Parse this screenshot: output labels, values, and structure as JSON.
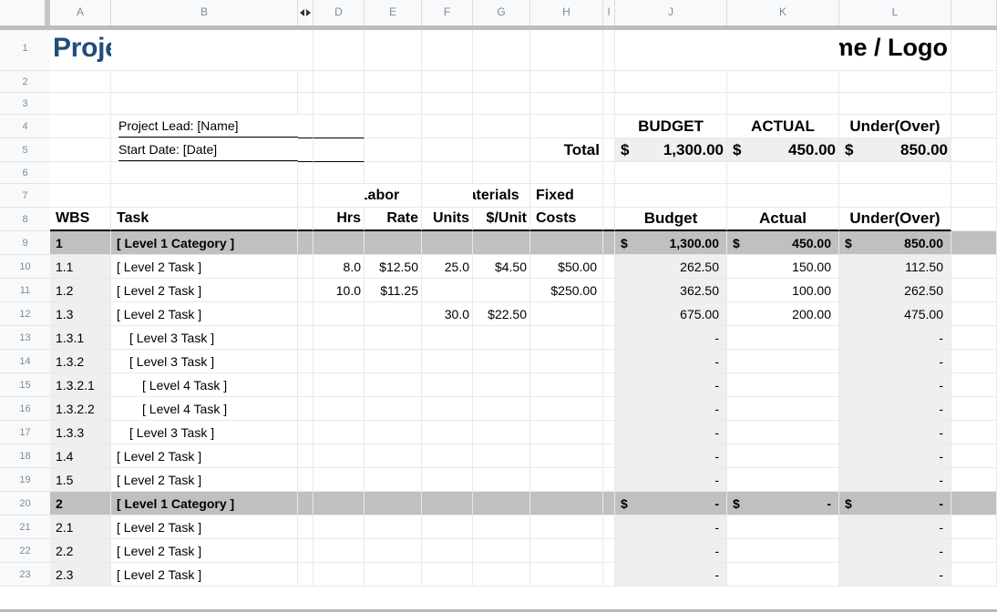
{
  "columns": {
    "letters": [
      "A",
      "B",
      "D",
      "E",
      "F",
      "G",
      "H",
      "I",
      "J",
      "K",
      "L"
    ],
    "hidden_marker": "hidden-columns-c"
  },
  "rows": {
    "numbers": [
      "1",
      "2",
      "3",
      "4",
      "5",
      "6",
      "7",
      "8",
      "9",
      "10",
      "11",
      "12",
      "13",
      "14",
      "15",
      "16",
      "17",
      "18",
      "19",
      "20",
      "21",
      "22",
      "23"
    ]
  },
  "header": {
    "title": "Project Budget",
    "company": "Company Name / Logo"
  },
  "meta": {
    "project_lead": "Project Lead: [Name]",
    "start_date": "Start Date: [Date]"
  },
  "summary": {
    "budget_label": "BUDGET",
    "actual_label": "ACTUAL",
    "underover_label": "Under(Over)",
    "total_label": "Total",
    "budget_currency": "$",
    "budget_value": "1,300.00",
    "actual_currency": "$",
    "actual_value": "450.00",
    "underover_currency": "$",
    "underover_value": "850.00"
  },
  "table_header": {
    "group_labor": "Labor",
    "group_materials": "Materials",
    "group_fixed": "Fixed",
    "wbs": "WBS",
    "task": "Task",
    "hrs": "Hrs",
    "rate": "Rate",
    "units": "Units",
    "per_unit": "$/Unit",
    "costs": "Costs",
    "budget": "Budget",
    "actual": "Actual",
    "underover": "Under(Over)"
  },
  "table_rows": [
    {
      "type": "category",
      "wbs": "1",
      "task": "[ Level 1 Category ]",
      "indent": 0,
      "hrs": "",
      "rate": "",
      "units": "",
      "per_unit": "",
      "fixed": "",
      "budget_cur": "$",
      "budget": "1,300.00",
      "actual_cur": "$",
      "actual": "450.00",
      "uo_cur": "$",
      "uo": "850.00"
    },
    {
      "type": "task",
      "wbs": "1.1",
      "task": "[ Level 2 Task ]",
      "indent": 0,
      "hrs": "8.0",
      "rate": "$12.50",
      "units": "25.0",
      "per_unit": "$4.50",
      "fixed": "$50.00",
      "budget_cur": "",
      "budget": "262.50",
      "actual_cur": "",
      "actual": "150.00",
      "uo_cur": "",
      "uo": "112.50"
    },
    {
      "type": "task",
      "wbs": "1.2",
      "task": "[ Level 2 Task ]",
      "indent": 0,
      "hrs": "10.0",
      "rate": "$11.25",
      "units": "",
      "per_unit": "",
      "fixed": "$250.00",
      "budget_cur": "",
      "budget": "362.50",
      "actual_cur": "",
      "actual": "100.00",
      "uo_cur": "",
      "uo": "262.50"
    },
    {
      "type": "task",
      "wbs": "1.3",
      "task": "[ Level 2 Task ]",
      "indent": 0,
      "hrs": "",
      "rate": "",
      "units": "30.0",
      "per_unit": "$22.50",
      "fixed": "",
      "budget_cur": "",
      "budget": "675.00",
      "actual_cur": "",
      "actual": "200.00",
      "uo_cur": "",
      "uo": "475.00"
    },
    {
      "type": "task",
      "wbs": "1.3.1",
      "task": "[ Level 3 Task ]",
      "indent": 1,
      "hrs": "",
      "rate": "",
      "units": "",
      "per_unit": "",
      "fixed": "",
      "budget_cur": "",
      "budget": "-",
      "actual_cur": "",
      "actual": "",
      "uo_cur": "",
      "uo": "-"
    },
    {
      "type": "task",
      "wbs": "1.3.2",
      "task": "[ Level 3 Task ]",
      "indent": 1,
      "hrs": "",
      "rate": "",
      "units": "",
      "per_unit": "",
      "fixed": "",
      "budget_cur": "",
      "budget": "-",
      "actual_cur": "",
      "actual": "",
      "uo_cur": "",
      "uo": "-"
    },
    {
      "type": "task",
      "wbs": "1.3.2.1",
      "task": "[ Level 4 Task ]",
      "indent": 2,
      "hrs": "",
      "rate": "",
      "units": "",
      "per_unit": "",
      "fixed": "",
      "budget_cur": "",
      "budget": "-",
      "actual_cur": "",
      "actual": "",
      "uo_cur": "",
      "uo": "-"
    },
    {
      "type": "task",
      "wbs": "1.3.2.2",
      "task": "[ Level 4 Task ]",
      "indent": 2,
      "hrs": "",
      "rate": "",
      "units": "",
      "per_unit": "",
      "fixed": "",
      "budget_cur": "",
      "budget": "-",
      "actual_cur": "",
      "actual": "",
      "uo_cur": "",
      "uo": "-"
    },
    {
      "type": "task",
      "wbs": "1.3.3",
      "task": "[ Level 3 Task ]",
      "indent": 1,
      "hrs": "",
      "rate": "",
      "units": "",
      "per_unit": "",
      "fixed": "",
      "budget_cur": "",
      "budget": "-",
      "actual_cur": "",
      "actual": "",
      "uo_cur": "",
      "uo": "-"
    },
    {
      "type": "task",
      "wbs": "1.4",
      "task": "[ Level 2 Task ]",
      "indent": 0,
      "hrs": "",
      "rate": "",
      "units": "",
      "per_unit": "",
      "fixed": "",
      "budget_cur": "",
      "budget": "-",
      "actual_cur": "",
      "actual": "",
      "uo_cur": "",
      "uo": "-"
    },
    {
      "type": "task",
      "wbs": "1.5",
      "task": "[ Level 2 Task ]",
      "indent": 0,
      "hrs": "",
      "rate": "",
      "units": "",
      "per_unit": "",
      "fixed": "",
      "budget_cur": "",
      "budget": "-",
      "actual_cur": "",
      "actual": "",
      "uo_cur": "",
      "uo": "-"
    },
    {
      "type": "category",
      "wbs": "2",
      "task": "[ Level 1 Category ]",
      "indent": 0,
      "hrs": "",
      "rate": "",
      "units": "",
      "per_unit": "",
      "fixed": "",
      "budget_cur": "$",
      "budget": "-",
      "actual_cur": "$",
      "actual": "-",
      "uo_cur": "$",
      "uo": "-"
    },
    {
      "type": "task",
      "wbs": "2.1",
      "task": "[ Level 2 Task ]",
      "indent": 0,
      "hrs": "",
      "rate": "",
      "units": "",
      "per_unit": "",
      "fixed": "",
      "budget_cur": "",
      "budget": "-",
      "actual_cur": "",
      "actual": "",
      "uo_cur": "",
      "uo": "-"
    },
    {
      "type": "task",
      "wbs": "2.2",
      "task": "[ Level 2 Task ]",
      "indent": 0,
      "hrs": "",
      "rate": "",
      "units": "",
      "per_unit": "",
      "fixed": "",
      "budget_cur": "",
      "budget": "-",
      "actual_cur": "",
      "actual": "",
      "uo_cur": "",
      "uo": "-"
    },
    {
      "type": "task",
      "wbs": "2.3",
      "task": "[ Level 2 Task ]",
      "indent": 0,
      "hrs": "",
      "rate": "",
      "units": "",
      "per_unit": "",
      "fixed": "",
      "budget_cur": "",
      "budget": "-",
      "actual_cur": "",
      "actual": "",
      "uo_cur": "",
      "uo": "-"
    }
  ],
  "colors": {
    "title": "#1f4e79",
    "category_bg": "#c0c0c0",
    "shade_bg": "#efefef",
    "header_bg": "#f8f9fa"
  }
}
